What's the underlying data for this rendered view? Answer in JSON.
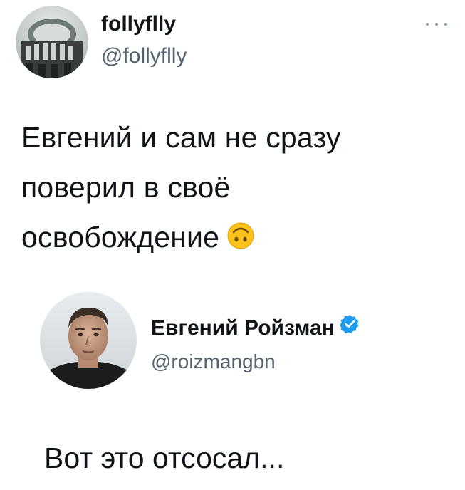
{
  "tweet": {
    "author": {
      "display_name": "follyflly",
      "handle": "@follyflly",
      "avatar_icon": "round-building-avatar-icon"
    },
    "more_icon": "more-options-icon",
    "text": "Евгений и сам не сразу\nповерил в своё\nосвобождение",
    "emoji_icon": "upside-down-face-emoji-icon"
  },
  "quoted_tweet": {
    "author": {
      "display_name": "Евгений Ройзман",
      "handle": "@roizmangbn",
      "avatar_icon": "man-portrait-avatar-icon",
      "verified_icon": "verified-badge-icon"
    },
    "text": "Вот это отсосал..."
  },
  "colors": {
    "text_primary": "#0f1419",
    "text_secondary": "#536471",
    "verified_blue": "#1d9bf0",
    "emoji_yellow": "#fcc21b"
  }
}
